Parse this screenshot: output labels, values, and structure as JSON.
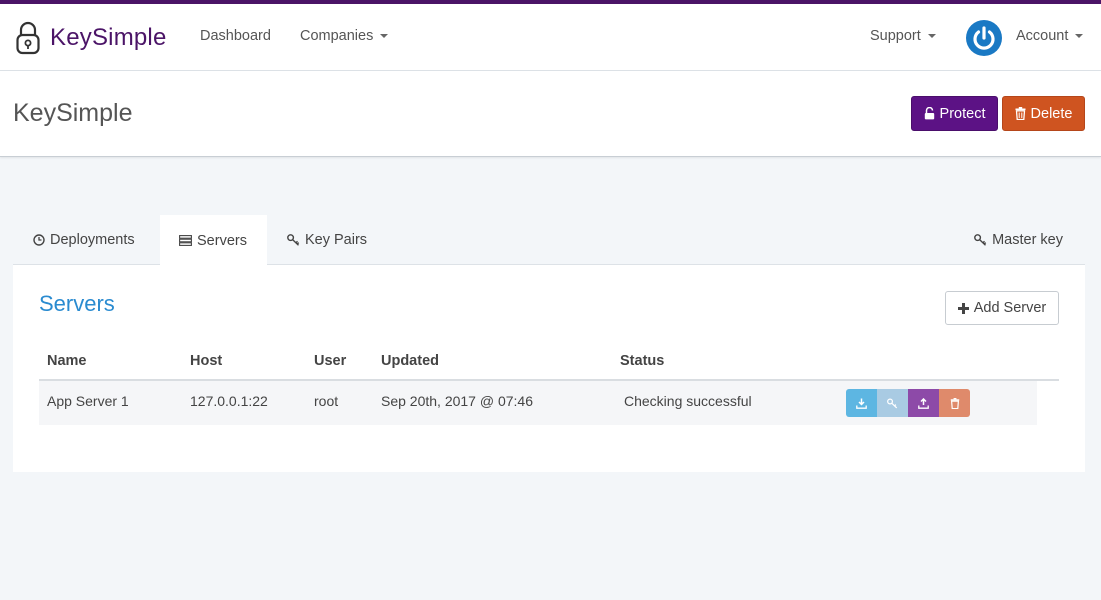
{
  "brand": {
    "name": "KeySimple"
  },
  "nav": {
    "dashboard": "Dashboard",
    "companies": "Companies",
    "support": "Support",
    "account": "Account"
  },
  "header": {
    "title": "KeySimple",
    "protect_label": "Protect",
    "delete_label": "Delete"
  },
  "tabs": {
    "deployments": "Deployments",
    "servers": "Servers",
    "key_pairs": "Key Pairs",
    "master_key": "Master key"
  },
  "servers": {
    "title": "Servers",
    "add_label": "Add Server",
    "columns": [
      "Name",
      "Host",
      "User",
      "Updated",
      "Status"
    ],
    "rows": [
      {
        "name": "App Server 1",
        "host": "127.0.0.1:22",
        "user": "root",
        "updated": "Sep 20th, 2017 @ 07:46",
        "status": "Checking successful"
      }
    ]
  },
  "colors": {
    "brand": "#4b1467",
    "protect": "#5c1285",
    "delete": "#cf5420",
    "link": "#2a8bd0"
  }
}
